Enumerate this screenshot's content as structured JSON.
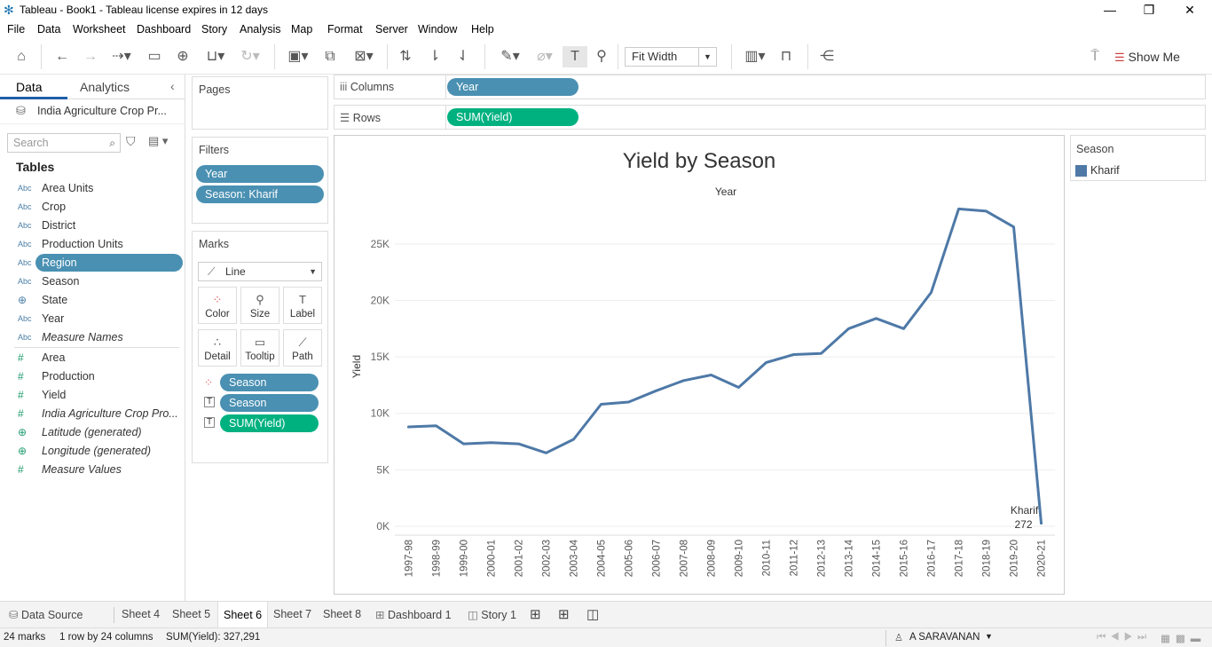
{
  "window": {
    "title": "Tableau - Book1 - Tableau license expires in 12 days"
  },
  "menu": [
    "File",
    "Data",
    "Worksheet",
    "Dashboard",
    "Story",
    "Analysis",
    "Map",
    "Format",
    "Server",
    "Window",
    "Help"
  ],
  "toolbar": {
    "fit": "Fit Width",
    "show_me": "Show Me"
  },
  "datapane": {
    "tab_data": "Data",
    "tab_analytics": "Analytics",
    "datasource": "India Agriculture Crop Pr...",
    "search_placeholder": "Search",
    "tables_heading": "Tables",
    "dimensions": [
      {
        "type": "Abc",
        "name": "Area Units"
      },
      {
        "type": "Abc",
        "name": "Crop"
      },
      {
        "type": "Abc",
        "name": "District"
      },
      {
        "type": "Abc",
        "name": "Production Units"
      },
      {
        "type": "Abc",
        "name": "Region"
      },
      {
        "type": "Abc",
        "name": "Season"
      },
      {
        "type": "geo",
        "name": "State"
      },
      {
        "type": "Abc",
        "name": "Year"
      },
      {
        "type": "Abc",
        "name": "Measure Names"
      }
    ],
    "measures": [
      {
        "type": "#",
        "name": "Area"
      },
      {
        "type": "#",
        "name": "Production"
      },
      {
        "type": "#",
        "name": "Yield"
      },
      {
        "type": "#",
        "name": "India Agriculture Crop Pro..."
      },
      {
        "type": "geo",
        "name": "Latitude (generated)"
      },
      {
        "type": "geo",
        "name": "Longitude (generated)"
      },
      {
        "type": "#",
        "name": "Measure Values"
      }
    ]
  },
  "pages": {
    "heading": "Pages"
  },
  "filters": {
    "heading": "Filters",
    "items": [
      "Year",
      "Season: Khartif"
    ]
  },
  "marks": {
    "heading": "Marks",
    "type": "Line",
    "buttons": [
      "Color",
      "Size",
      "Label",
      "Detail",
      "Tooltip",
      "Path"
    ],
    "pills": [
      "Season",
      "Season",
      "SUM(Yield)"
    ]
  },
  "shelves": {
    "columns_label": "Columns",
    "columns_pill": "Year",
    "rows_label": "Rows",
    "rows_pill": "SUM(Yield)"
  },
  "legend": {
    "title": "Season",
    "item": "Kharif",
    "color": "#4e79a7"
  },
  "chart_data": {
    "type": "line",
    "title": "Yield by Season",
    "xlabel": "Year",
    "ylabel": "Yield",
    "x": [
      "1997-98",
      "1998-99",
      "1999-00",
      "2000-01",
      "2001-02",
      "2002-03",
      "2003-04",
      "2004-05",
      "2005-06",
      "2006-07",
      "2007-08",
      "2008-09",
      "2009-10",
      "2010-11",
      "2011-12",
      "2012-13",
      "2013-14",
      "2014-15",
      "2015-16",
      "2016-17",
      "2017-18",
      "2018-19",
      "2019-20",
      "2020-21"
    ],
    "series": [
      {
        "name": "Kharif",
        "values": [
          8800,
          8900,
          7300,
          7400,
          7300,
          6500,
          7700,
          10800,
          11000,
          12000,
          12900,
          13400,
          12300,
          14500,
          15200,
          15300,
          17500,
          18400,
          17500,
          20700,
          28100,
          27900,
          26500,
          272
        ]
      }
    ],
    "yticks": [
      "0K",
      "5K",
      "10K",
      "15K",
      "20K",
      "25K"
    ],
    "ylim": [
      0,
      30000
    ],
    "label_text": "Kharif",
    "label_value": "272",
    "color": "#4e79a7",
    "grid": true
  },
  "sheets": [
    "Data Source",
    "Sheet 4",
    "Sheet 5",
    "Sheet 6",
    "Sheet 7",
    "Sheet 8",
    "Dashboard 1",
    "Story 1"
  ],
  "active_sheet": "Sheet 6",
  "status": {
    "marks": "24 marks",
    "dims": "1 row by 24 columns",
    "sum": "SUM(Yield): 327,291",
    "user": "A SARAVANAN"
  }
}
